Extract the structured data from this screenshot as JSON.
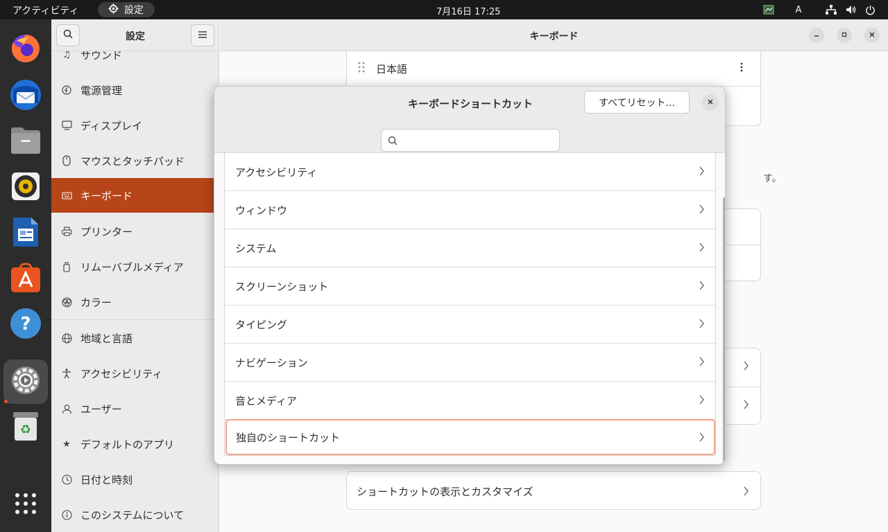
{
  "topbar": {
    "activities": "アクティビティ",
    "app_name": "設定",
    "clock": "7月16日  17:25",
    "input_method": "A"
  },
  "dock": {
    "items": [
      {
        "icon": "firefox-icon"
      },
      {
        "icon": "thunderbird-icon"
      },
      {
        "icon": "files-icon"
      },
      {
        "icon": "rhythmbox-icon"
      },
      {
        "icon": "libreoffice-writer-icon"
      },
      {
        "icon": "app-center-icon"
      },
      {
        "icon": "help-icon"
      },
      {
        "icon": "settings-icon"
      },
      {
        "icon": "trash-icon"
      },
      {
        "icon": "show-apps-icon"
      }
    ]
  },
  "settings": {
    "sidebar_title": "設定",
    "main_title": "キーボード",
    "sidebar_items": [
      {
        "label": "サウンド",
        "icon": "music-note-icon"
      },
      {
        "label": "電源管理",
        "icon": "power-icon"
      },
      {
        "label": "ディスプレイ",
        "icon": "display-icon"
      },
      {
        "label": "マウスとタッチパッド",
        "icon": "mouse-icon"
      },
      {
        "label": "キーボード",
        "icon": "keyboard-icon"
      },
      {
        "label": "プリンター",
        "icon": "printer-icon"
      },
      {
        "label": "リムーバブルメディア",
        "icon": "media-icon"
      },
      {
        "label": "カラー",
        "icon": "color-icon"
      },
      {
        "label": "地域と言語",
        "icon": "globe-icon"
      },
      {
        "label": "アクセシビリティ",
        "icon": "accessibility-icon"
      },
      {
        "label": "ユーザー",
        "icon": "user-icon"
      },
      {
        "label": "デフォルトのアプリ",
        "icon": "star-icon"
      },
      {
        "label": "日付と時刻",
        "icon": "clock-icon"
      },
      {
        "label": "このシステムについて",
        "icon": "info-icon"
      }
    ],
    "selected_item": "キーボード",
    "input_source": "日本語",
    "partial_text": "す。",
    "view_shortcuts": "ショートカットの表示とカスタマイズ"
  },
  "dialog": {
    "title": "キーボードショートカット",
    "reset_button": "すべてリセット...",
    "search_placeholder": "",
    "categories": [
      "アクセシビリティ",
      "ウィンドウ",
      "システム",
      "スクリーンショット",
      "タイピング",
      "ナビゲーション",
      "音とメディア",
      "独自のショートカット"
    ],
    "focused_category": "独自のショートカット"
  },
  "colors": {
    "accent": "#e95420",
    "selected_sidebar": "#b8451a",
    "focus_ring": "#f0a48a"
  }
}
